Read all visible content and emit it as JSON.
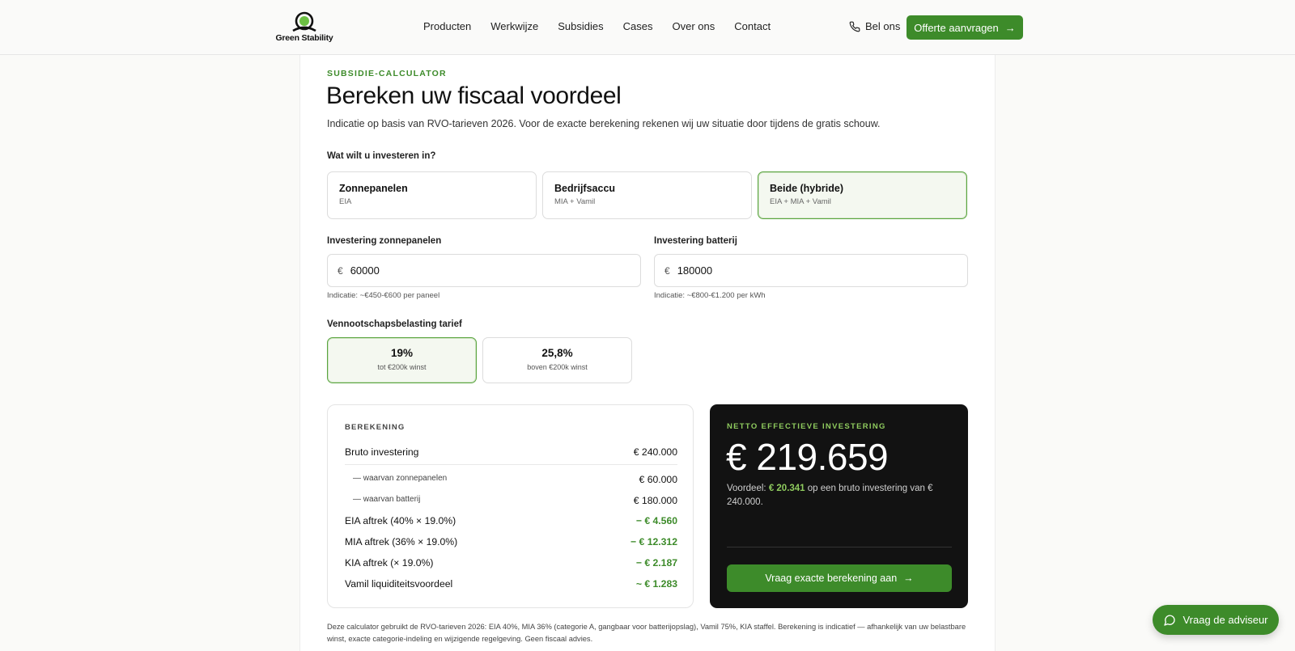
{
  "brand": {
    "name": "Green Stability"
  },
  "nav": {
    "items": [
      "Producten",
      "Werkwijze",
      "Subsidies",
      "Cases",
      "Over ons",
      "Contact"
    ]
  },
  "header": {
    "call_label": "Bel ons",
    "cta_label": "Offerte aanvragen"
  },
  "intro": {
    "eyebrow": "SUBSIDIE-CALCULATOR",
    "title": "Bereken uw fiscaal voordeel",
    "text": "Indicatie op basis van RVO-tarieven 2026. Voor de exacte berekening rekenen wij uw situatie door tijdens de gratis schouw."
  },
  "investment_question": "Wat wilt u investeren in?",
  "options": [
    {
      "title": "Zonnepanelen",
      "sub": "EIA"
    },
    {
      "title": "Bedrijfsaccu",
      "sub": "MIA + Vamil"
    },
    {
      "title": "Beide (hybride)",
      "sub": "EIA + MIA + Vamil"
    }
  ],
  "inputs": {
    "solar": {
      "label": "Investering zonnepanelen",
      "currency": "€",
      "value": "60000",
      "hint": "Indicatie: ~€450-€600 per paneel"
    },
    "battery": {
      "label": "Investering batterij",
      "currency": "€",
      "value": "180000",
      "hint": "Indicatie: ~€800-€1.200 per kWh"
    }
  },
  "tax": {
    "label": "Vennootschapsbelasting tarief",
    "options": [
      {
        "pct": "19%",
        "sub": "tot €200k winst"
      },
      {
        "pct": "25,8%",
        "sub": "boven €200k winst"
      }
    ]
  },
  "calculation": {
    "heading": "BEREKENING",
    "rows": [
      {
        "label": "Bruto investering",
        "value": "€ 240.000"
      },
      {
        "label": "— waarvan zonnepanelen",
        "value": "€ 60.000"
      },
      {
        "label": "— waarvan batterij",
        "value": "€ 180.000"
      },
      {
        "label": "EIA aftrek (40% × 19.0%)",
        "value": "− € 4.560"
      },
      {
        "label": "MIA aftrek (36% × 19.0%)",
        "value": "− € 12.312"
      },
      {
        "label": "KIA aftrek (× 19.0%)",
        "value": "− € 2.187"
      },
      {
        "label": "Vamil liquiditeitsvoordeel",
        "value": "~ € 1.283"
      }
    ]
  },
  "result": {
    "eyebrow": "NETTO EFFECTIEVE INVESTERING",
    "amount": "€ 219.659",
    "prefix": "Voordeel:",
    "advantage": "€ 20.341",
    "suffix": "op een bruto investering van € 240.000.",
    "button_label": "Vraag exacte berekening aan"
  },
  "footnote": "Deze calculator gebruikt de RVO-tarieven 2026: EIA 40%, MIA 36% (categorie A, gangbaar voor batterijopslag), Vamil 75%, KIA staffel. Berekening is indicatief — afhankelijk van uw belastbare winst, exacte categorie-indeling en wijzigende regelgeving. Geen fiscaal advies.",
  "chat": {
    "label": "Vraag de adviseur"
  },
  "colors": {
    "accent": "#3d8b2a",
    "accent_light": "#8fcb5e",
    "dark_card": "#121212"
  }
}
